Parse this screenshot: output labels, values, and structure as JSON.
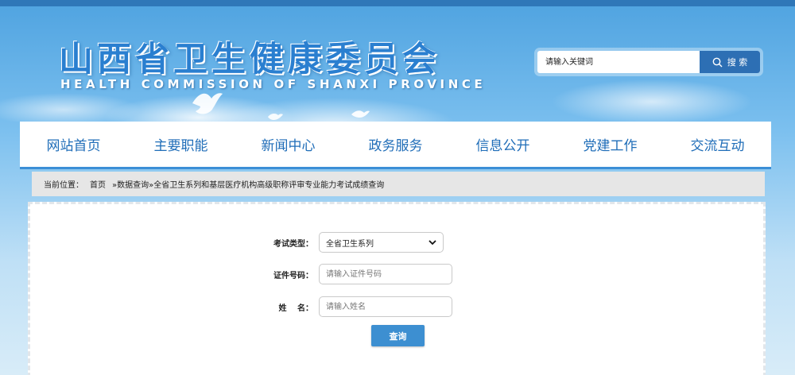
{
  "header": {
    "title_cn": "山西省卫生健康委员会",
    "title_en": "HEALTH COMMISSION OF SHANXI PROVINCE",
    "search": {
      "placeholder": "请输入关键词",
      "button_label": "搜 索",
      "icon": "search-icon"
    }
  },
  "nav": {
    "items": [
      {
        "label": "网站首页"
      },
      {
        "label": "主要职能"
      },
      {
        "label": "新闻中心"
      },
      {
        "label": "政务服务"
      },
      {
        "label": "信息公开"
      },
      {
        "label": "党建工作"
      },
      {
        "label": "交流互动"
      }
    ]
  },
  "breadcrumb": {
    "prefix": "当前位置：",
    "home": "首页",
    "path": "»数据查询»全省卫生系列和基层医疗机构高级职称评审专业能力考试成绩查询"
  },
  "form": {
    "exam_type_label": "考试类型：",
    "exam_type_value": "全省卫生系列",
    "id_label": "证件号码：",
    "id_placeholder": "请输入证件号码",
    "name_label": "姓　 名：",
    "name_placeholder": "请输入姓名",
    "submit_label": "查询"
  },
  "colors": {
    "nav_text": "#1f6db8",
    "search_button": "#2d6fb4",
    "submit_button": "#3d8fd1"
  }
}
